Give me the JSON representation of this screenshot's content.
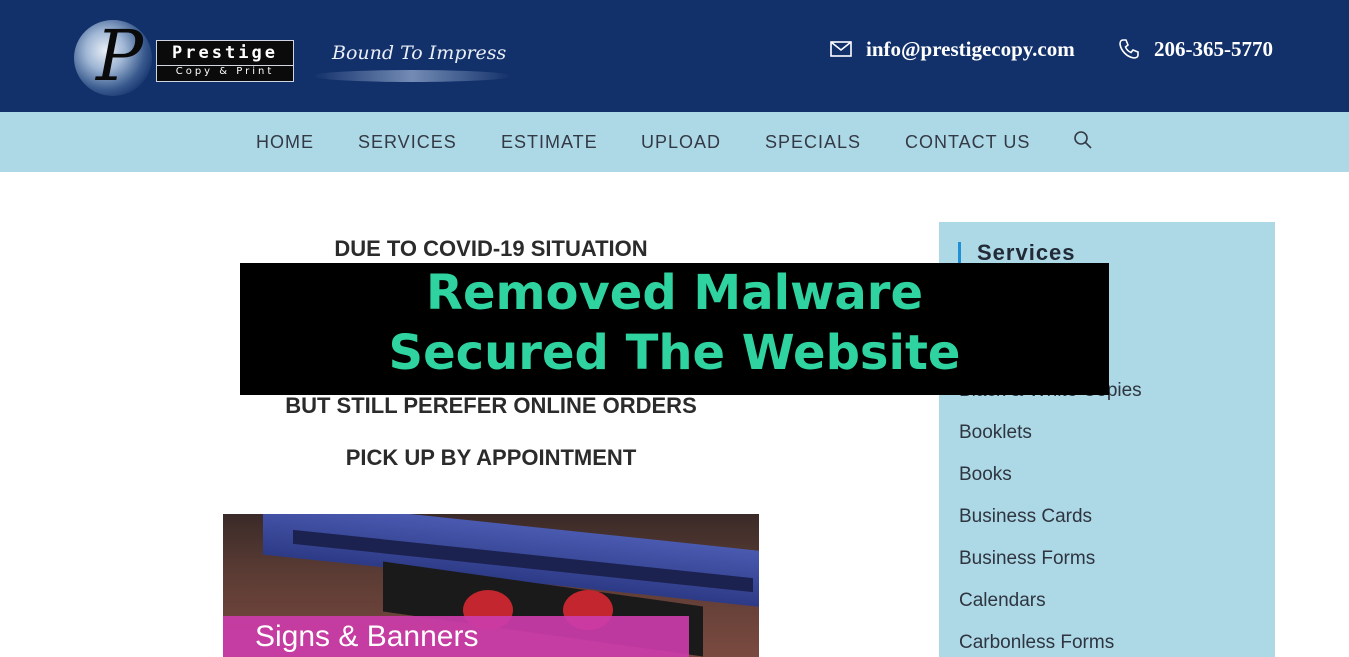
{
  "header": {
    "brand_name": "Prestige",
    "brand_sub": "Copy & Print",
    "tagline": "Bound To Impress",
    "email": "info@prestigecopy.com",
    "phone": "206-365-5770"
  },
  "nav": {
    "items": [
      "HOME",
      "SERVICES",
      "ESTIMATE",
      "UPLOAD",
      "SPECIALS",
      "CONTACT US"
    ]
  },
  "notice": {
    "line1": "DUE TO COVID-19 SITUATION",
    "line2": "BUT STILL PEREFER ONLINE ORDERS",
    "line3": "PICK UP BY APPOINTMENT"
  },
  "overlay": {
    "line1": "Removed Malware",
    "line2": "Secured The Website"
  },
  "banner": {
    "label": "Signs & Banners"
  },
  "sidebar": {
    "title": "Services",
    "partial1": "s",
    "partial2": "Black & White Copies",
    "items": [
      "Booklets",
      "Books",
      "Business Cards",
      "Business Forms",
      "Calendars",
      "Carbonless Forms"
    ]
  },
  "colors": {
    "header_bg": "#12306a",
    "nav_bg": "#add8e6",
    "overlay_text": "#2fd3a0"
  }
}
